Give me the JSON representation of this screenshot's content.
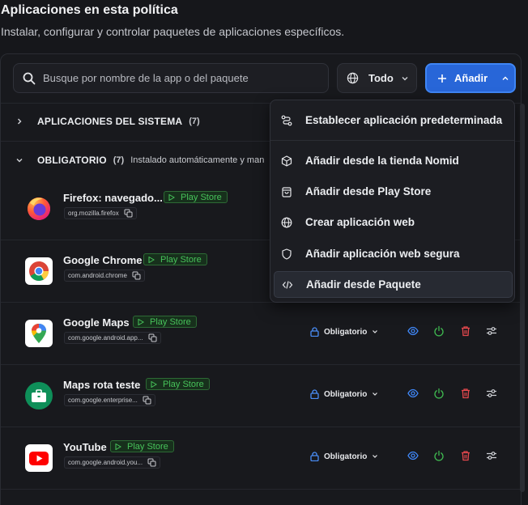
{
  "page": {
    "title": "Aplicaciones en esta política",
    "subtitle": "Instalar, configurar y controlar paquetes de aplicaciones específicos."
  },
  "toolbar": {
    "search_placeholder": "Busque por nombre de la app o del paquete",
    "filter_label": "Todo",
    "add_label": "Añadir"
  },
  "groups": [
    {
      "name": "APLICACIONES DEL SISTEMA",
      "count": "(7)",
      "description": ""
    },
    {
      "name": "OBLIGATORIO",
      "count": "(7)",
      "description": "Instalado automáticamente y man"
    }
  ],
  "apps": [
    {
      "name": "Firefox: navegado...",
      "store": "Play Store",
      "package": "org.mozilla.firefox",
      "policy": ""
    },
    {
      "name": "Google Chrome",
      "store": "Play Store",
      "package": "com.android.chrome",
      "policy": ""
    },
    {
      "name": "Google Maps",
      "store": "Play Store",
      "package": "com.google.android.app...",
      "policy": "Obligatorio"
    },
    {
      "name": "Maps rota teste",
      "store": "Play Store",
      "package": "com.google.enterprise...",
      "policy": "Obligatorio"
    },
    {
      "name": "YouTube",
      "store": "Play Store",
      "package": "com.google.android.you...",
      "policy": "Obligatorio"
    }
  ],
  "add_menu": {
    "items": [
      {
        "label": "Establecer aplicación predeterminada",
        "icon": "route-icon"
      },
      {
        "label": "Añadir desde la tienda Nomid",
        "icon": "box-icon"
      },
      {
        "label": "Añadir desde Play Store",
        "icon": "shopping-bag-icon"
      },
      {
        "label": "Crear aplicación web",
        "icon": "globe-icon"
      },
      {
        "label": "Añadir aplicación web segura",
        "icon": "shield-icon"
      },
      {
        "label": "Añadir desde Paquete",
        "icon": "code-icon"
      }
    ],
    "active_index": 5
  },
  "colors": {
    "accent": "#2866d8",
    "store_green": "#47c25a",
    "delete_red": "#e5484d",
    "view_blue": "#3f86f5"
  }
}
